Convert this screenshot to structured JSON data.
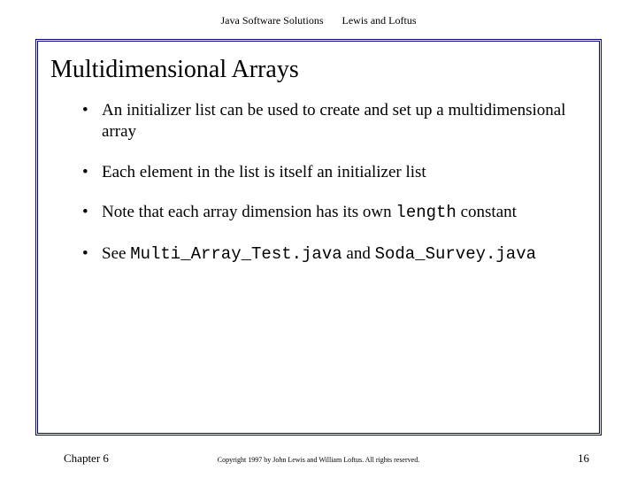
{
  "header": {
    "left": "Java Software Solutions",
    "right": "Lewis and Loftus"
  },
  "title": "Multidimensional Arrays",
  "bullets": {
    "b0": "An initializer list can be used to create and set up a multidimensional array",
    "b1": "Each element in the list is itself an initializer list",
    "b2_pre": "Note that each array dimension has its own ",
    "b2_code": "length",
    "b2_post": " constant",
    "b3_pre": "See ",
    "b3_code1": "Multi_Array_Test.java",
    "b3_mid": " and ",
    "b3_code2": "Soda_Survey.java"
  },
  "footer": {
    "left": "Chapter 6",
    "center": "Copyright 1997 by John Lewis and William Loftus. All rights reserved.",
    "right": "16"
  }
}
